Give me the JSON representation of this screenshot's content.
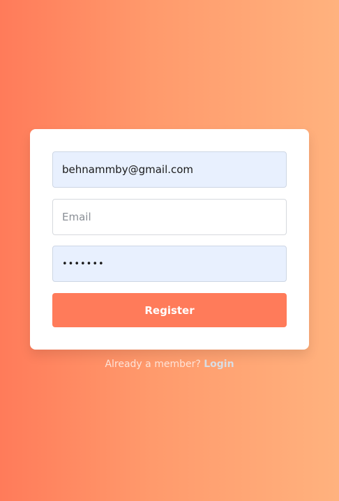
{
  "form": {
    "username_value": "behnammby@gmail.com",
    "email_placeholder": "Email",
    "email_value": "",
    "password_value": "•••••••",
    "register_label": "Register"
  },
  "footer": {
    "prompt": "Already a member?",
    "login_label": "Login"
  },
  "colors": {
    "accent": "#ff7b5a",
    "gradient_start": "#ff7b5a",
    "gradient_end": "#ffb27e",
    "autofill_background": "#e8f0fe"
  }
}
